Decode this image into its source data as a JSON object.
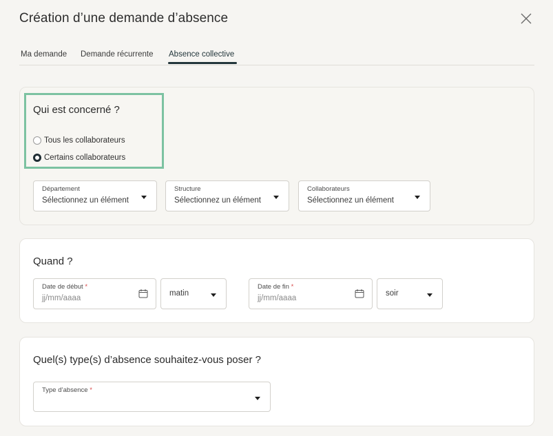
{
  "modal": {
    "title": "Création d’une demande d’absence",
    "close_icon": "close-icon"
  },
  "tabs": [
    {
      "label": "Ma demande",
      "active": false
    },
    {
      "label": "Demande récurrente",
      "active": false
    },
    {
      "label": "Absence collective",
      "active": true
    }
  ],
  "who": {
    "title": "Qui est concerné ?",
    "options": [
      {
        "label": "Tous les collaborateurs",
        "checked": false
      },
      {
        "label": "Certains collaborateurs",
        "checked": true
      }
    ],
    "selects": [
      {
        "label": "Département",
        "value": "Sélectionnez un élément"
      },
      {
        "label": "Structure",
        "value": "Sélectionnez un élément"
      },
      {
        "label": "Collaborateurs",
        "value": "Sélectionnez un élément"
      }
    ],
    "highlight_color": "#7cc2a1"
  },
  "when": {
    "title": "Quand ?",
    "start_date": {
      "label": "Date de début",
      "required_mark": "*",
      "placeholder": "jj/mm/aaaa"
    },
    "start_period": "matin",
    "end_date": {
      "label": "Date de fin",
      "required_mark": "*",
      "placeholder": "jj/mm/aaaa"
    },
    "end_period": "soir"
  },
  "type": {
    "title": "Quel(s) type(s) d’absence souhaitez-vous poser ?",
    "field": {
      "label": "Type d’absence",
      "required_mark": "*",
      "value": ""
    }
  },
  "colors": {
    "accent": "#23363b",
    "required": "#d94a4a",
    "background": "#f6f5f2"
  }
}
